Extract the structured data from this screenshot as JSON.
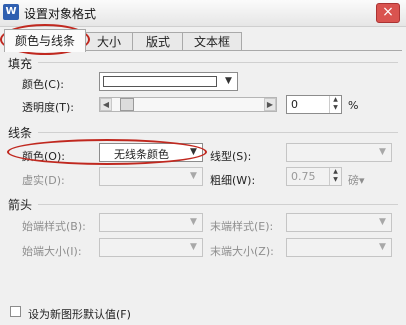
{
  "window": {
    "title": "设置对象格式",
    "app_icon": "wps-writer-icon",
    "close_label": "×"
  },
  "tabs": [
    {
      "label": "颜色与线条",
      "active": true
    },
    {
      "label": "大小",
      "active": false
    },
    {
      "label": "版式",
      "active": false
    },
    {
      "label": "文本框",
      "active": false
    }
  ],
  "fill": {
    "section_label": "填充",
    "color_label": "颜色(C):",
    "color_value": "#ffffff",
    "transparency_label": "透明度(T):",
    "transparency_value": "0",
    "transparency_unit": "%"
  },
  "line": {
    "section_label": "线条",
    "color_label": "颜色(O):",
    "color_value": "无线条颜色",
    "style_label": "线型(S):",
    "style_value": "",
    "dash_label": "虚实(D):",
    "dash_value": "",
    "weight_label": "粗细(W):",
    "weight_value": "0.75",
    "weight_unit": "磅"
  },
  "arrows": {
    "section_label": "箭头",
    "begin_style_label": "始端样式(B):",
    "end_style_label": "末端样式(E):",
    "begin_size_label": "始端大小(I):",
    "end_size_label": "末端大小(Z):"
  },
  "default_checkbox": {
    "label": "设为新图形默认值(F)",
    "checked": false
  },
  "colors": {
    "highlight_oval": "#c0281f"
  }
}
